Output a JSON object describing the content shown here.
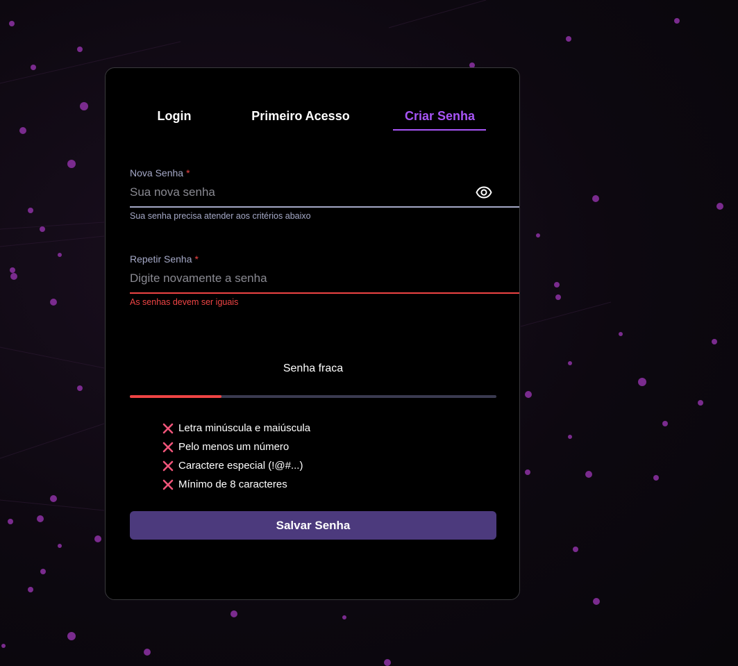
{
  "tabs": [
    {
      "label": "Login",
      "active": false
    },
    {
      "label": "Primeiro Acesso",
      "active": false
    },
    {
      "label": "Criar Senha",
      "active": true
    }
  ],
  "new_password": {
    "label": "Nova Senha",
    "required_mark": "*",
    "placeholder": "Sua nova senha",
    "helper": "Sua senha precisa atender aos critérios abaixo",
    "toggle_icon": "eye-icon"
  },
  "repeat_password": {
    "label": "Repetir Senha",
    "required_mark": "*",
    "placeholder": "Digite novamente a senha",
    "error": "As senhas devem ser iguais"
  },
  "strength": {
    "label": "Senha fraca",
    "level": 0.25
  },
  "requirements": [
    {
      "label": "Letra minúscula e maiúscula",
      "met": false,
      "icon": "x-icon"
    },
    {
      "label": "Pelo menos um número",
      "met": false,
      "icon": "x-icon"
    },
    {
      "label": "Caractere especial (!@#...)",
      "met": false,
      "icon": "x-icon"
    },
    {
      "label": "Mínimo de 8 caracteres",
      "met": false,
      "icon": "x-icon"
    }
  ],
  "save_button": {
    "label": "Salvar Senha"
  },
  "colors": {
    "accent": "#a855f7",
    "error": "#ef4444",
    "button": "#4c3a7d",
    "unmet_icon": "#f0557a"
  }
}
